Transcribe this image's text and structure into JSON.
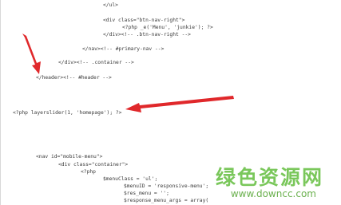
{
  "code_lines": [
    "</ul>",
    "<div class=\"btn-nav-right\">",
    "<?php _e('Menu', 'junkie'); ?>",
    "</div><!-- .btn-nav-right -->",
    "</nav><!-- #primary-nav -->",
    "</div><!-- .container -->",
    "</header><!-- #header -->",
    "<?php layerslider(1, 'homepage'); ?>",
    "<nav id=\"mobile-menu\">",
    "<div class=\"container\">",
    "<?php",
    "$menuClass = 'ul';",
    "$menuID = 'responsive-menu';",
    "$res_menu = '';",
    "$response_menu_args = array("
  ],
  "watermark": {
    "text": "绿色资源网",
    "url": "www.downcc.com"
  },
  "colors": {
    "arrow": "#e0282b",
    "watermark": "#6cc24a"
  }
}
